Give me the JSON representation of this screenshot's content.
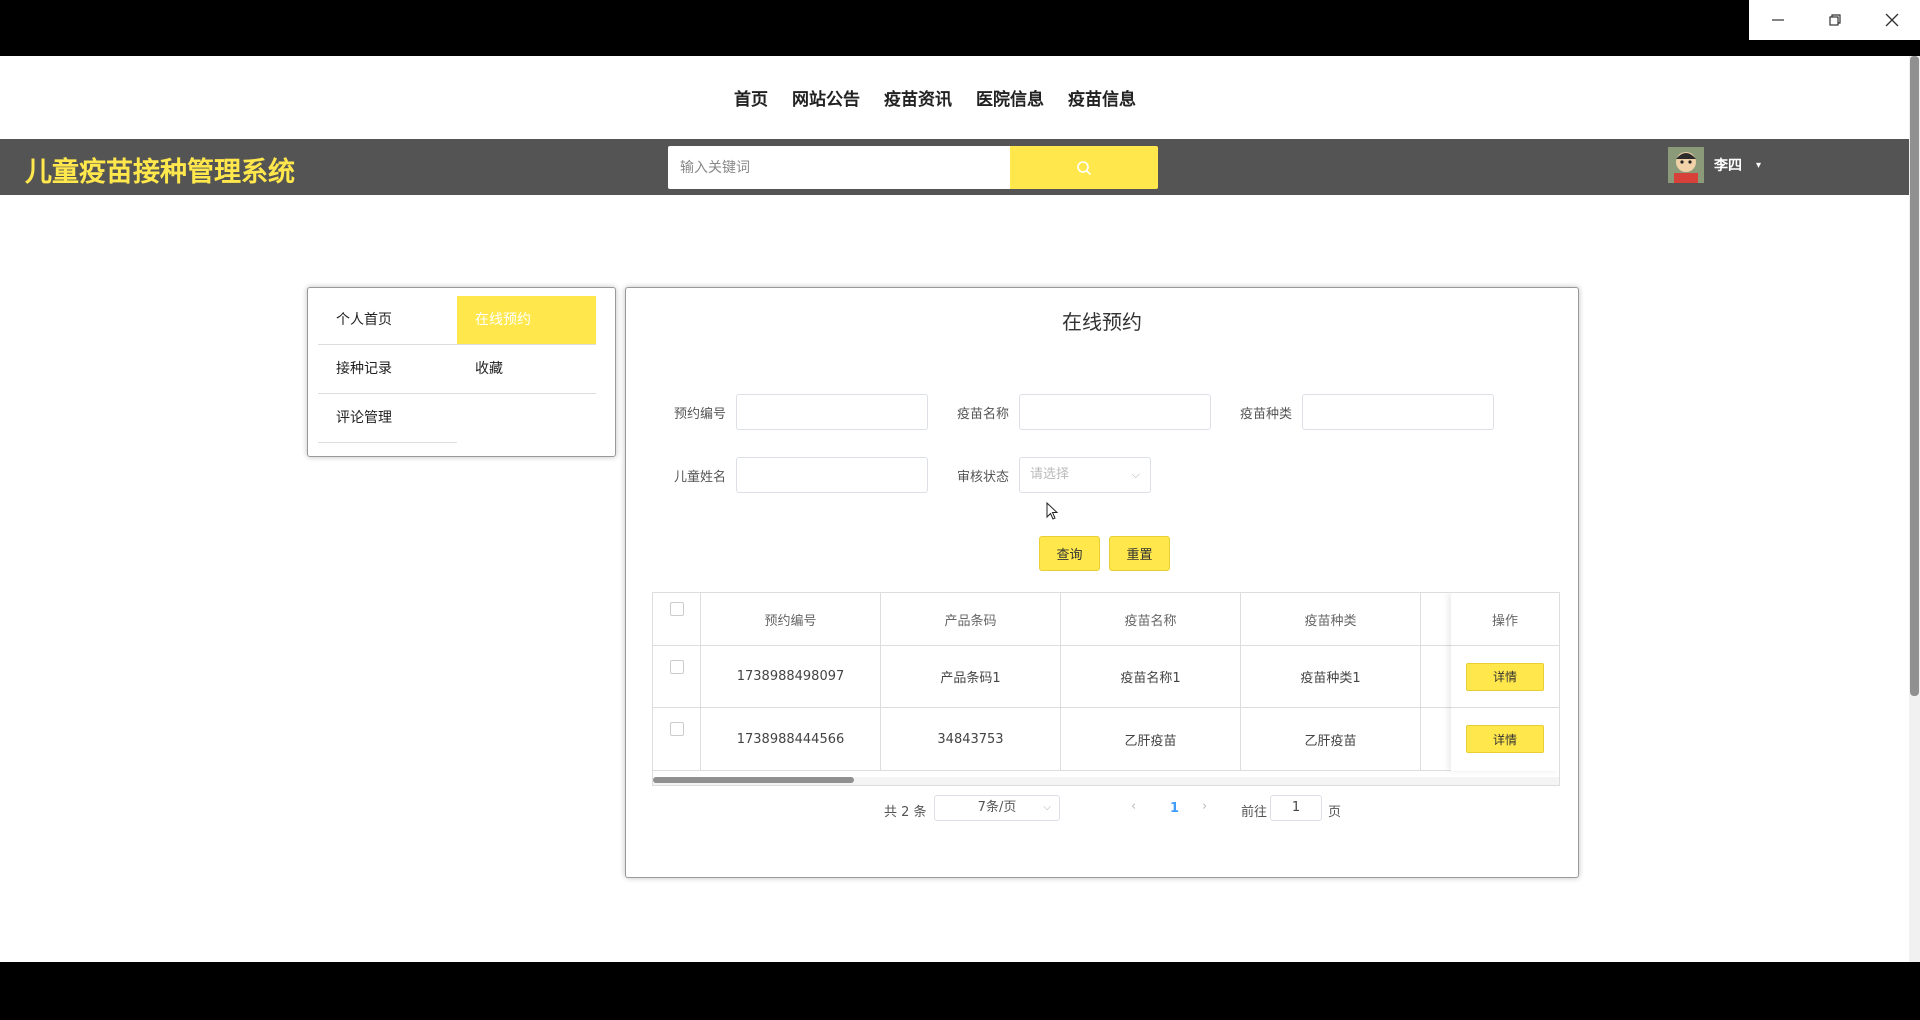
{
  "window": {
    "controls": [
      "minimize",
      "restore",
      "close"
    ]
  },
  "nav": {
    "items": [
      "首页",
      "网站公告",
      "疫苗资讯",
      "医院信息",
      "疫苗信息"
    ]
  },
  "header": {
    "title": "儿童疫苗接种管理系统",
    "search_placeholder": "输入关键词",
    "username": "李四",
    "accent": "#FFE74C",
    "bar_color": "#545454"
  },
  "side_menu": {
    "items": [
      {
        "label": "个人首页",
        "active": false
      },
      {
        "label": "在线预约",
        "active": true
      },
      {
        "label": "接种记录",
        "active": false
      },
      {
        "label": "收藏",
        "active": false
      },
      {
        "label": "评论管理",
        "active": false
      }
    ]
  },
  "panel": {
    "title": "在线预约",
    "filters": {
      "booking_no": "预约编号",
      "vaccine_name": "疫苗名称",
      "vaccine_type": "疫苗种类",
      "child_name": "儿童姓名",
      "review_status": "审核状态",
      "review_placeholder": "请选择"
    },
    "buttons": {
      "query": "查询",
      "reset": "重置"
    }
  },
  "table": {
    "headers": [
      "预约编号",
      "产品条码",
      "疫苗名称",
      "疫苗种类"
    ],
    "op_header": "操作",
    "rows": [
      [
        "1738988498097",
        "产品条码1",
        "疫苗名称1",
        "疫苗种类1"
      ],
      [
        "1738988444566",
        "34843753",
        "乙肝疫苗",
        "乙肝疫苗"
      ]
    ],
    "detail_label": "详情"
  },
  "pagination": {
    "total": "共 2 条",
    "page_size": "7条/页",
    "current_page": "1",
    "goto_label": "前往",
    "goto_value": "1",
    "page_suffix": "页"
  }
}
